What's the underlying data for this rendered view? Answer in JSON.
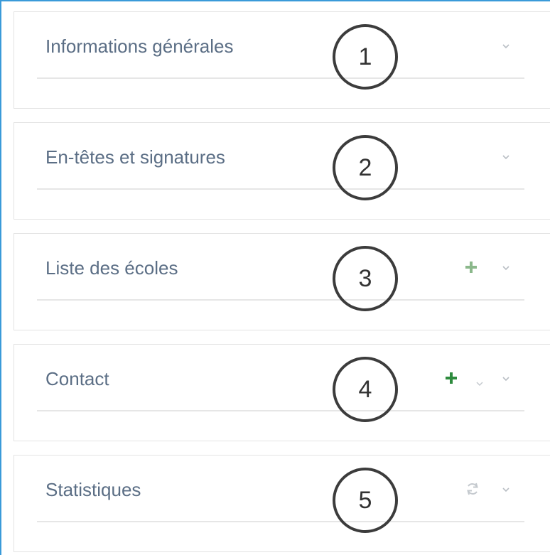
{
  "panels": [
    {
      "title": "Informations générales",
      "number": "1",
      "actions": [
        "chevron-down"
      ]
    },
    {
      "title": "En-têtes et signatures",
      "number": "2",
      "actions": [
        "chevron-down"
      ]
    },
    {
      "title": "Liste des écoles",
      "number": "3",
      "actions": [
        "plus",
        "chevron-down"
      ]
    },
    {
      "title": "Contact",
      "number": "4",
      "actions": [
        "plus",
        "caret-down",
        "chevron-down"
      ]
    },
    {
      "title": "Statistiques",
      "number": "5",
      "actions": [
        "refresh",
        "chevron-down"
      ]
    }
  ],
  "colors": {
    "frame_border": "#3a9ad9",
    "title_text": "#5b6e85",
    "plus_light": "#8bb88b",
    "plus_dark": "#2e8b3e",
    "icon_gray": "#b9bec4",
    "badge_border": "#3c3c3c"
  }
}
